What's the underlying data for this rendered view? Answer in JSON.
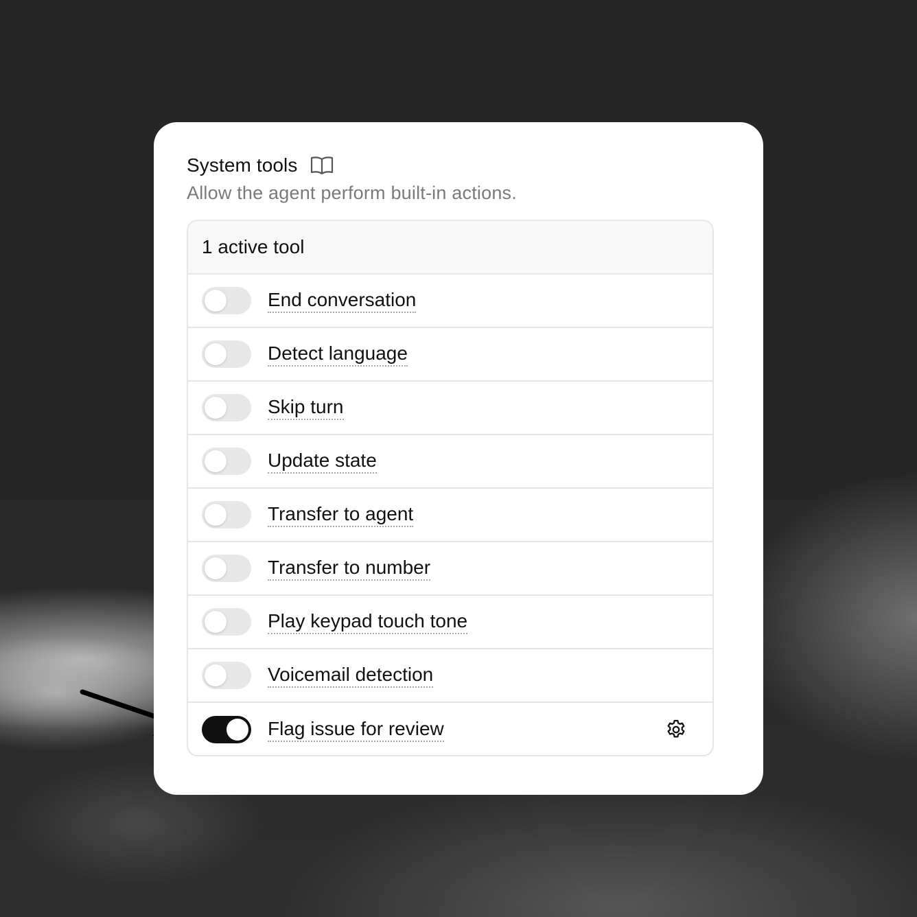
{
  "panel": {
    "title": "System tools",
    "title_icon": "book-open-icon",
    "subtitle": "Allow the agent perform built-in actions.",
    "active_count_label": "1 active tool"
  },
  "tools": [
    {
      "label": "End conversation",
      "enabled": false
    },
    {
      "label": "Detect language",
      "enabled": false
    },
    {
      "label": "Skip turn",
      "enabled": false
    },
    {
      "label": "Update state",
      "enabled": false
    },
    {
      "label": "Transfer to agent",
      "enabled": false
    },
    {
      "label": "Transfer to number",
      "enabled": false
    },
    {
      "label": "Play keypad touch tone",
      "enabled": false
    },
    {
      "label": "Voicemail detection",
      "enabled": false
    },
    {
      "label": "Flag issue for review",
      "enabled": true,
      "settings_icon": "gear-icon"
    }
  ],
  "annotation": {
    "icon": "arrow-pointer-icon",
    "points_to": "Flag issue for review"
  },
  "colors": {
    "toggle_on": "#111111",
    "toggle_off": "#e8e8e8",
    "border": "#e6e6e6",
    "subtitle_text": "#7a7a7a"
  }
}
